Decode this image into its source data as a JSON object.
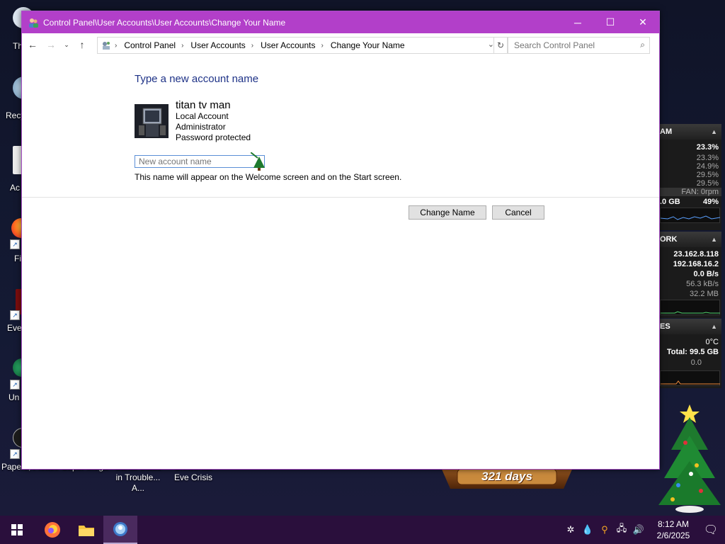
{
  "window": {
    "title": "Control Panel\\User Accounts\\User Accounts\\Change Your Name"
  },
  "navigation": {
    "breadcrumbs": [
      "Control Panel",
      "User Accounts",
      "User Accounts",
      "Change Your Name"
    ],
    "search_placeholder": "Search Control Panel"
  },
  "page": {
    "heading": "Type a new account name",
    "account": {
      "name": "titan tv man",
      "type": "Local Account",
      "role": "Administrator",
      "protection": "Password protected"
    },
    "input_placeholder": "New account name",
    "hint": "This name will appear on the Welcome screen and on the Start screen.",
    "change_button": "Change Name",
    "cancel_button": "Cancel"
  },
  "desktop": {
    "icons": [
      {
        "label": "Th",
        "icon": "this-pc-icon"
      },
      {
        "label": "Recy",
        "icon": "recycle-bin-icon"
      },
      {
        "label": "Ac",
        "icon": "acrobat-icon"
      },
      {
        "label": "Fi",
        "icon": "firefox-icon"
      },
      {
        "label": "Eve",
        "icon": "game-icon"
      },
      {
        "label": "Un",
        "icon": "game-icon"
      },
      {
        "label": "Papers, Please",
        "icon": "game-icon"
      }
    ],
    "bottom_labels": [
      "Super Mega",
      "Santa Claus in Trouble... A...",
      "Christmas Eve Crisis"
    ],
    "countdown": "321 days"
  },
  "gadgets": {
    "ram": {
      "title": "AM",
      "total_pct": "23.3%",
      "cores": [
        "23.3%",
        "24.9%",
        "29.5%",
        "29.5%"
      ],
      "fan": "FAN: 0rpm",
      "mem": ".0 GB",
      "mem_pct": "49%"
    },
    "network": {
      "title": "ORK",
      "ip1": "23.162.8.118",
      "ip2": "192.168.16.2",
      "speed": "0.0 B/s",
      "down": "56.3 kB/s",
      "total": "32.2 MB"
    },
    "drives": {
      "title": "ES",
      "temp": "0°C",
      "total": "Total: 99.5 GB",
      "val": "0.0"
    }
  },
  "taskbar": {
    "time": "8:12 AM",
    "date": "2/6/2025"
  },
  "colors": {
    "titlebar": "#b23fc9",
    "heading": "#1e3287",
    "taskbar": "#2a0f3c"
  }
}
